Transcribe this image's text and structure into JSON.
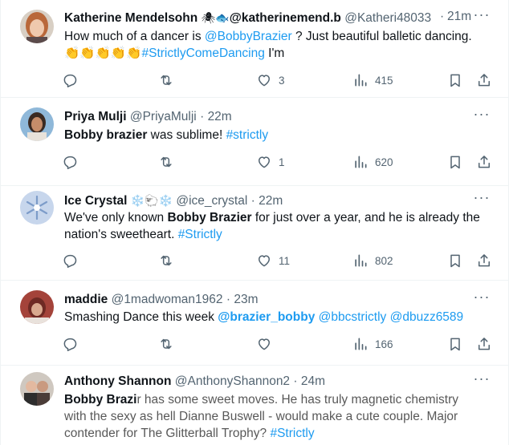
{
  "tweets": [
    {
      "name": "Katherine Mendelsohn",
      "name_emojis": "🕷🐟",
      "handle_extra": "@katherinemend.b",
      "handle": "@Katheri48033",
      "dot": "·",
      "time": "21m",
      "text_1": "How much of a dancer is ",
      "mention": "@BobbyBrazier",
      "text_2": " ? Just beautiful balletic dancing.",
      "clap_emojis": "👏👏👏👏👏",
      "hashtag": "#StrictlyComeDancing",
      "text_3": " I'm",
      "likes": "3",
      "views": "415"
    },
    {
      "name": "Priya Mulji",
      "handle": "@PriyaMulji",
      "dot": "·",
      "time": "22m",
      "bold_text": "Bobby brazier",
      "text_1": " was sublime! ",
      "hashtag": "#strictly",
      "likes": "1",
      "views": "620"
    },
    {
      "name": "Ice Crystal",
      "name_emojis": "❄️🐑❄️",
      "handle": "@ice_crystal",
      "dot": "·",
      "time": "22m",
      "text_1": "We've only known ",
      "bold_text": "Bobby Brazier",
      "text_2": " for just over a year, and he is already the",
      "text_3": "nation's sweetheart. ",
      "hashtag": "#Strictly",
      "likes": "11",
      "views": "802"
    },
    {
      "name": "maddie",
      "handle": "@1madwoman1962",
      "dot": "·",
      "time": "23m",
      "text_1": "Smashing Dance this week ",
      "mention_1": "@brazier_bobby",
      "mention_2": "@bbcstrictly",
      "mention_3": "@dbuzz6589",
      "views": "166"
    },
    {
      "name": "Anthony Shannon",
      "handle": "@AnthonyShannon2",
      "dot": "·",
      "time": "24m",
      "bold_text": "Bobby Brazi",
      "text_1": "r has some sweet moves. He has truly magnetic chemistry",
      "text_2": "with the sexy as hell Dianne Buswell - would make a cute couple. Major",
      "text_3": "contender for The Glitterball Trophy? ",
      "hashtag": "#Strictly"
    }
  ],
  "icons": {
    "more": "more-icon",
    "reply": "reply-icon",
    "retweet": "retweet-icon",
    "like": "heart-icon",
    "views": "views-icon",
    "bookmark": "bookmark-icon",
    "share": "share-icon"
  },
  "colors": {
    "link": "#1d9bf0",
    "muted": "#536471",
    "text": "#0f1419",
    "divider": "#eff3f4"
  }
}
